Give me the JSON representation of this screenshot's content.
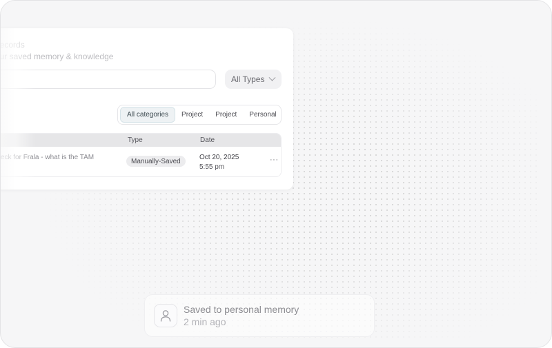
{
  "records": {
    "title": "n Records",
    "subtitle": "l your saved memory & knowledge",
    "search": {
      "value": "",
      "placeholder": ""
    },
    "type_filter": {
      "selected": "All Types"
    },
    "categories": [
      "All categories",
      "Project",
      "Project",
      "Personal"
    ],
    "active_category": "All categories",
    "table": {
      "columns": [
        "Type",
        "Date"
      ],
      "rows": [
        {
          "title": "ch deck for Frala - what is the TAM",
          "type": "Manually-Saved",
          "date": "Oct 20, 2025",
          "time": "5:55 pm",
          "menu": "···"
        }
      ]
    }
  },
  "toast": {
    "title": "Saved to personal memory",
    "subtitle": "2 min ago",
    "icon": "user-icon"
  }
}
